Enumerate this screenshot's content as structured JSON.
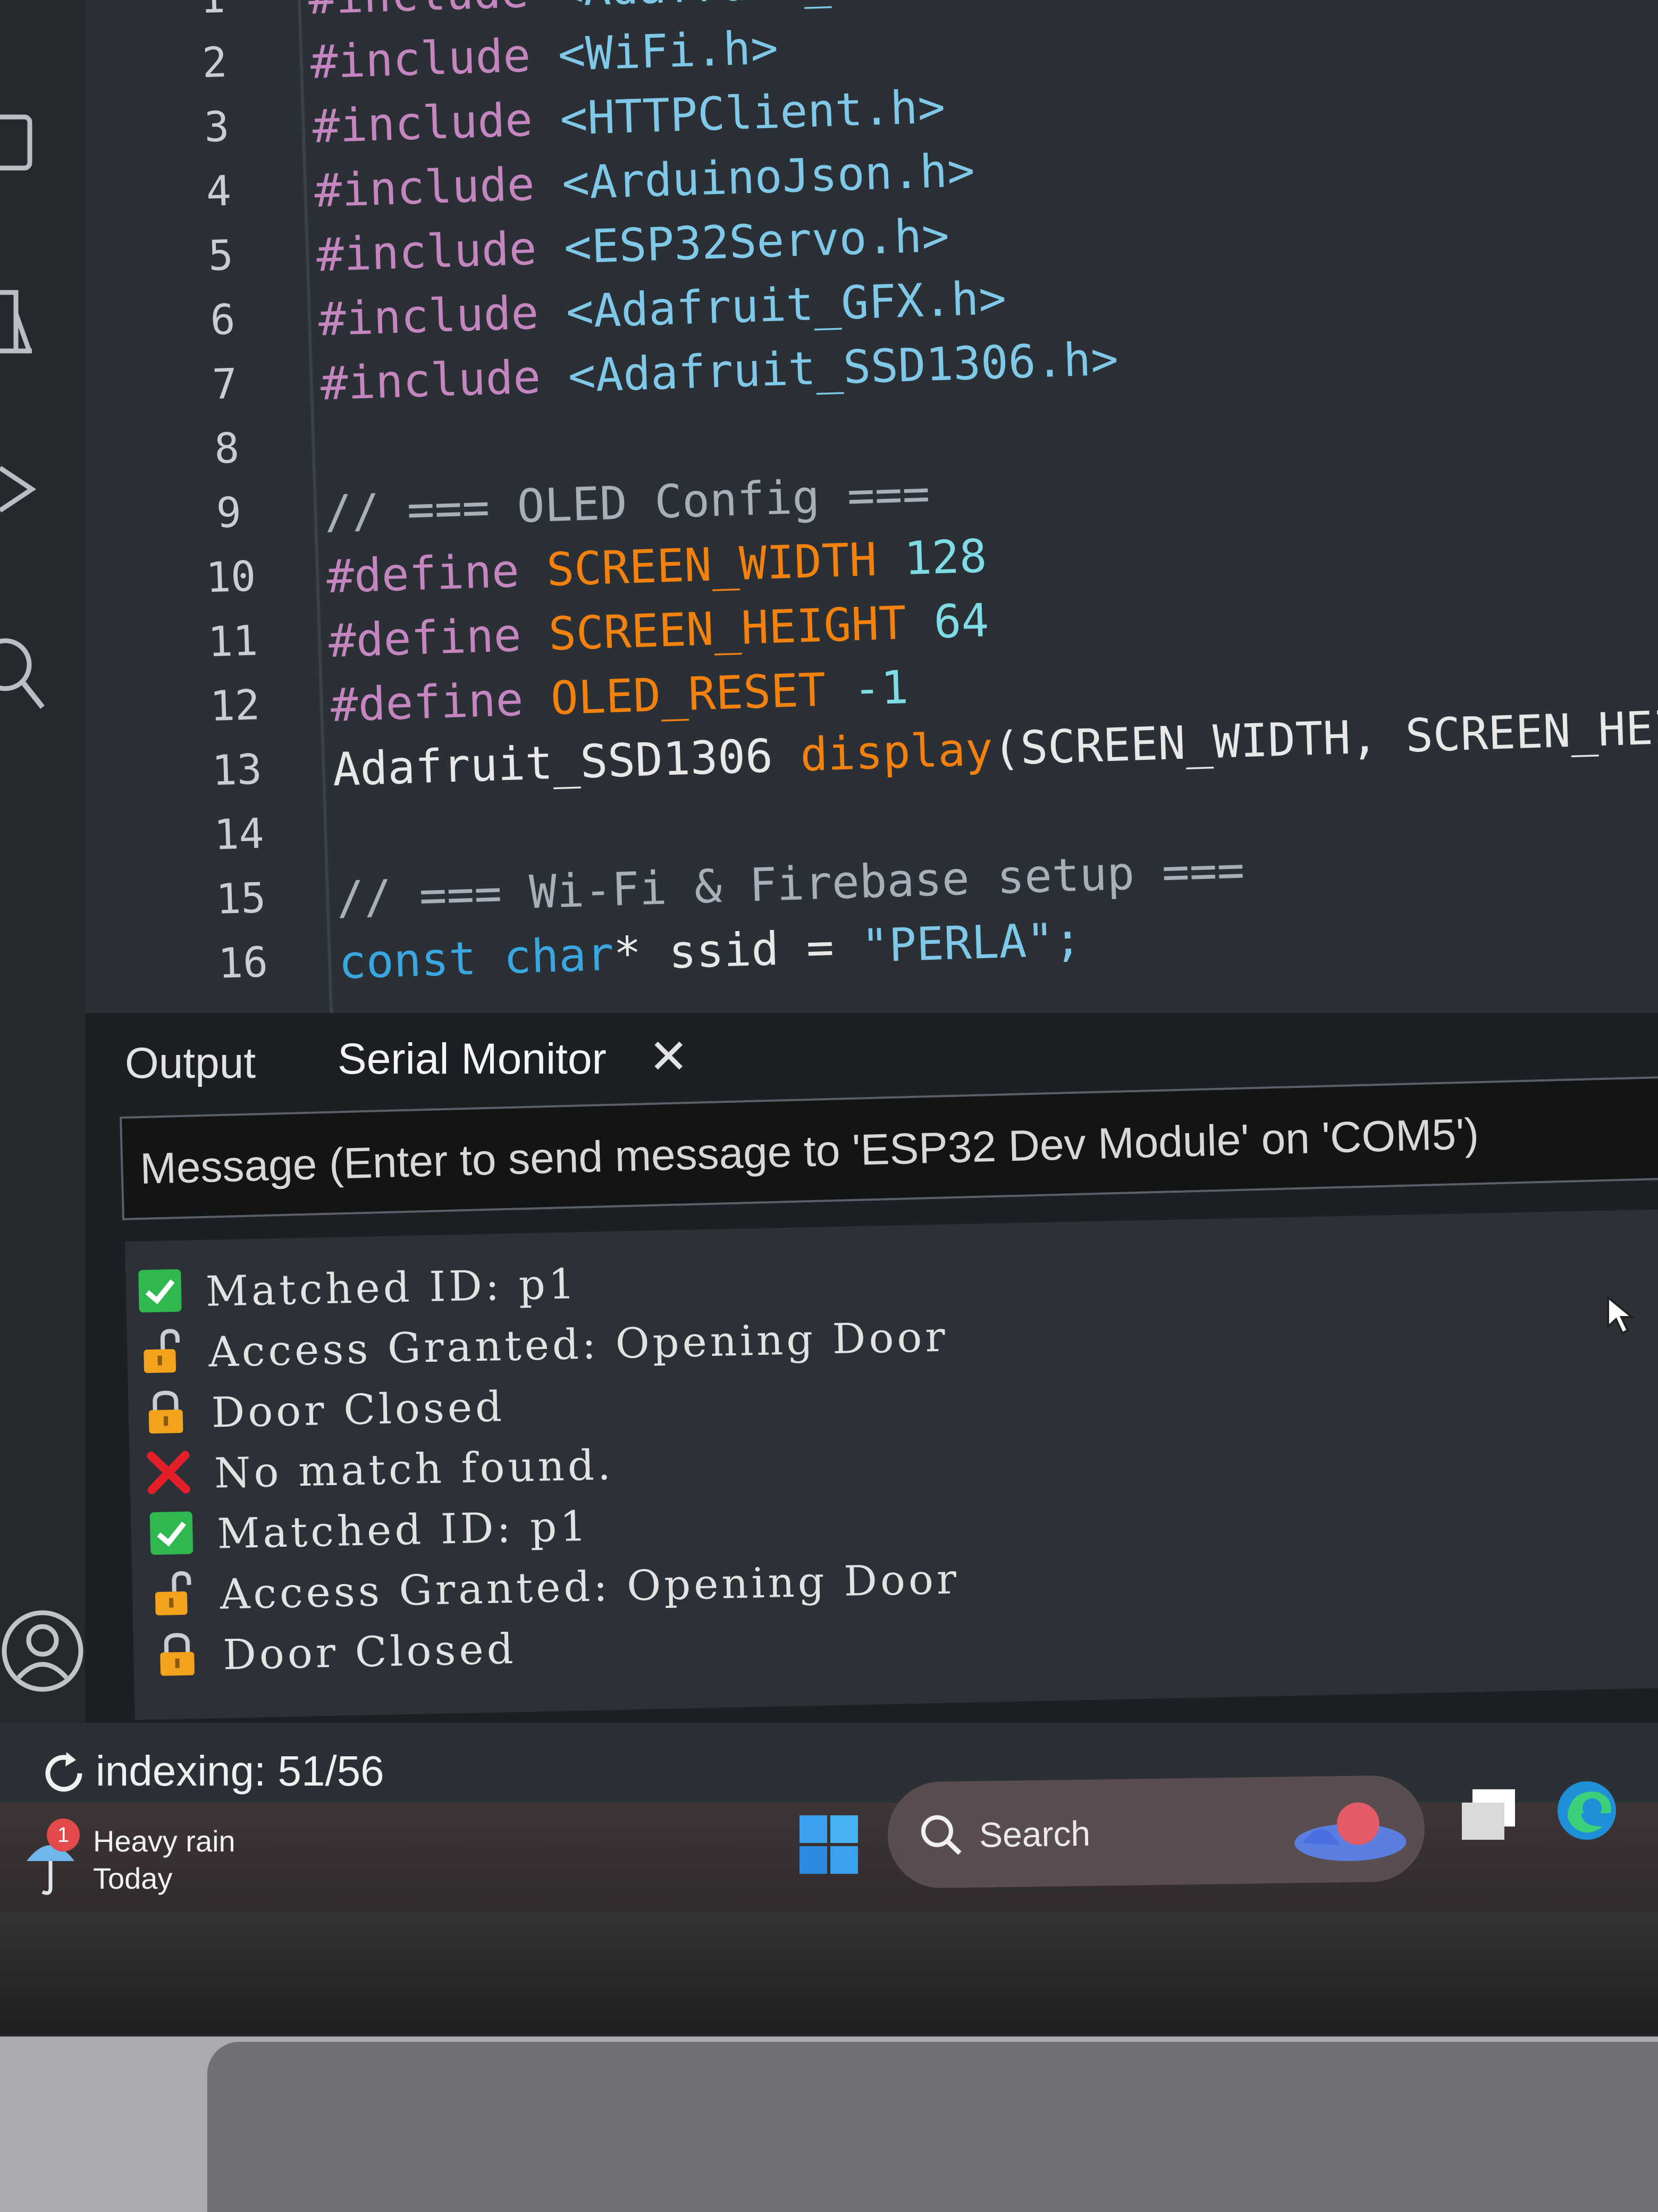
{
  "editor": {
    "lines": [
      {
        "n": "1",
        "tokens": [
          {
            "t": "#include",
            "c": "pp"
          },
          {
            "t": " <Adafruit_",
            "c": "str"
          }
        ]
      },
      {
        "n": "2",
        "tokens": [
          {
            "t": "#include",
            "c": "pp"
          },
          {
            "t": " <WiFi.h>",
            "c": "str"
          }
        ]
      },
      {
        "n": "3",
        "tokens": [
          {
            "t": "#include",
            "c": "pp"
          },
          {
            "t": " <HTTPClient.h>",
            "c": "str"
          }
        ]
      },
      {
        "n": "4",
        "tokens": [
          {
            "t": "#include",
            "c": "pp"
          },
          {
            "t": " <ArduinoJson.h>",
            "c": "str"
          }
        ]
      },
      {
        "n": "5",
        "tokens": [
          {
            "t": "#include",
            "c": "pp"
          },
          {
            "t": " <ESP32Servo.h>",
            "c": "str"
          }
        ]
      },
      {
        "n": "6",
        "tokens": [
          {
            "t": "#include",
            "c": "pp"
          },
          {
            "t": " <Adafruit_GFX.h>",
            "c": "str"
          }
        ]
      },
      {
        "n": "7",
        "tokens": [
          {
            "t": "#include",
            "c": "pp"
          },
          {
            "t": " <Adafruit_SSD1306.h>",
            "c": "str"
          }
        ]
      },
      {
        "n": "8",
        "tokens": []
      },
      {
        "n": "9",
        "tokens": [
          {
            "t": "// === OLED Config ===",
            "c": "comment"
          }
        ]
      },
      {
        "n": "10",
        "tokens": [
          {
            "t": "#define",
            "c": "pp"
          },
          {
            "t": " SCREEN_WIDTH",
            "c": "const"
          },
          {
            "t": " 128",
            "c": "num"
          }
        ]
      },
      {
        "n": "11",
        "tokens": [
          {
            "t": "#define",
            "c": "pp"
          },
          {
            "t": " SCREEN_HEIGHT",
            "c": "const"
          },
          {
            "t": " 64",
            "c": "num"
          }
        ]
      },
      {
        "n": "12",
        "tokens": [
          {
            "t": "#define",
            "c": "pp"
          },
          {
            "t": " OLED_RESET",
            "c": "const"
          },
          {
            "t": " -1",
            "c": "num"
          }
        ]
      },
      {
        "n": "13",
        "tokens": [
          {
            "t": "Adafruit_SSD1306 ",
            "c": "plain"
          },
          {
            "t": "display",
            "c": "fn"
          },
          {
            "t": "(SCREEN_WIDTH, SCREEN_HEIG",
            "c": "plain"
          }
        ]
      },
      {
        "n": "14",
        "tokens": []
      },
      {
        "n": "15",
        "tokens": [
          {
            "t": "// === Wi-Fi & Firebase setup ===",
            "c": "comment"
          }
        ]
      },
      {
        "n": "16",
        "tokens": [
          {
            "t": "const",
            "c": "kw"
          },
          {
            "t": " char",
            "c": "kw"
          },
          {
            "t": "* ssid = ",
            "c": "plain"
          },
          {
            "t": "\"PERLA\";",
            "c": "str"
          }
        ]
      }
    ]
  },
  "panel": {
    "tabs": [
      {
        "label": "Output"
      },
      {
        "label": "Serial Monitor"
      }
    ],
    "close_symbol": "✕",
    "message_placeholder": "Message (Enter to send message to 'ESP32 Dev Module' on 'COM5')",
    "log": [
      {
        "icon": "check-mark-icon",
        "text": "Matched ID: p1"
      },
      {
        "icon": "unlocked-icon",
        "text": "Access Granted: Opening Door"
      },
      {
        "icon": "locked-icon",
        "text": "Door Closed"
      },
      {
        "icon": "cross-mark-icon",
        "text": "No match found."
      },
      {
        "icon": "check-mark-icon",
        "text": "Matched ID: p1"
      },
      {
        "icon": "unlocked-icon",
        "text": "Access Granted: Opening Door"
      },
      {
        "icon": "locked-icon",
        "text": "Door Closed"
      }
    ]
  },
  "status_bar": {
    "indexing": "indexing: 51/56"
  },
  "taskbar": {
    "weather_badge": "1",
    "weather_title": "Heavy rain",
    "weather_subtitle": "Today",
    "search_placeholder": "Search"
  },
  "colors": {
    "check": "#2fb84f",
    "cross": "#e3202a",
    "lock": "#f2a21b"
  }
}
